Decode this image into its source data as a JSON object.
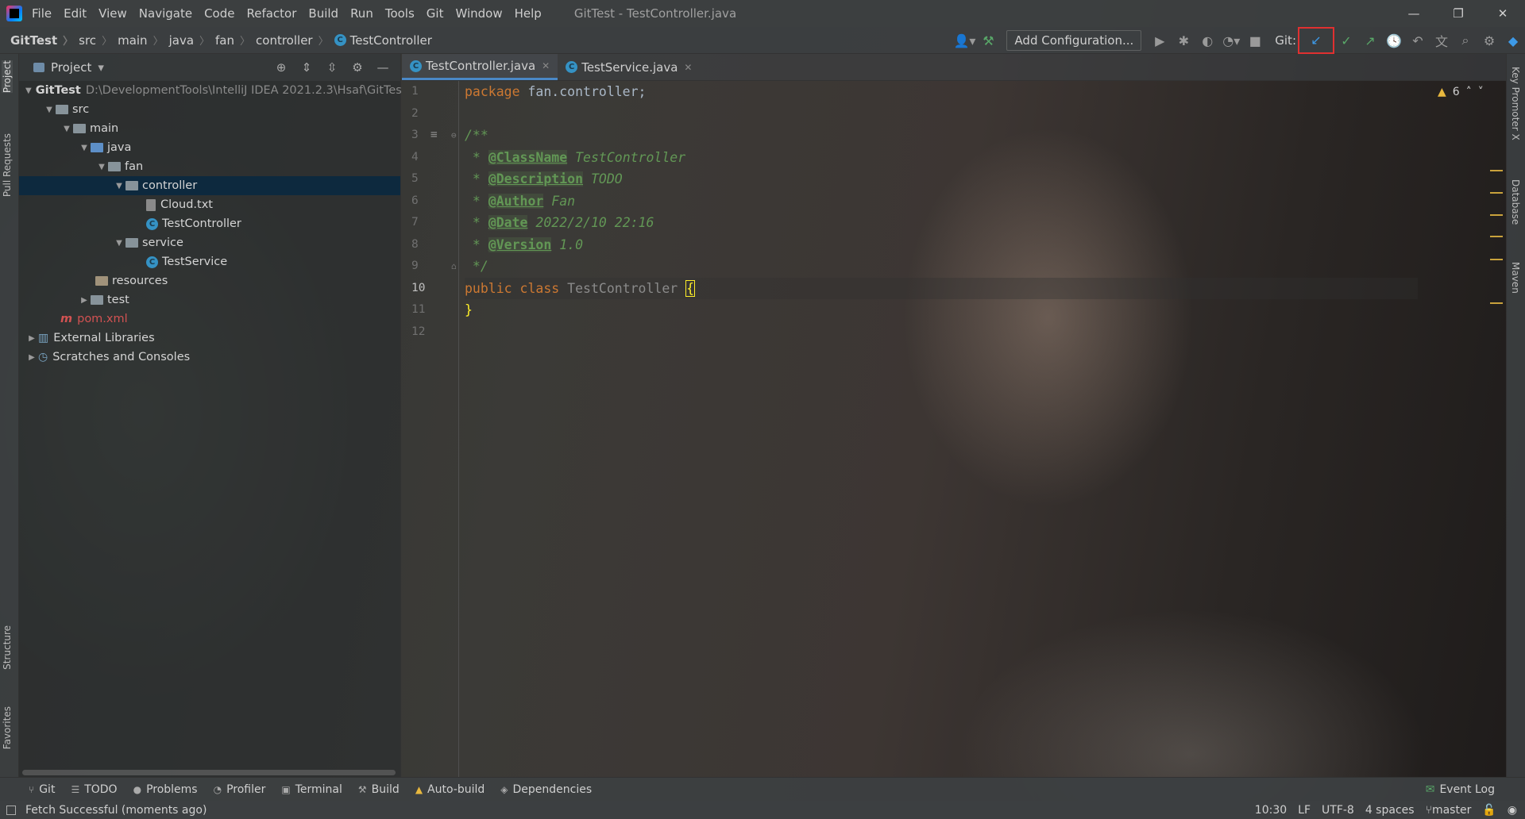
{
  "window": {
    "title": "GitTest - TestController.java",
    "controls": [
      "—",
      "❐",
      "✕"
    ]
  },
  "menu": [
    "File",
    "Edit",
    "View",
    "Navigate",
    "Code",
    "Refactor",
    "Build",
    "Run",
    "Tools",
    "Git",
    "Window",
    "Help"
  ],
  "breadcrumbs": [
    "GitTest",
    "src",
    "main",
    "java",
    "fan",
    "controller",
    "TestController"
  ],
  "toolbar": {
    "add_configuration": "Add Configuration...",
    "git_label": "Git:"
  },
  "left_stripe": {
    "project": "Project",
    "pull_requests": "Pull Requests",
    "structure": "Structure",
    "favorites": "Favorites"
  },
  "project_panel": {
    "title": "Project",
    "tree": [
      {
        "label": "GitTest",
        "path": "D:\\DevelopmentTools\\IntelliJ IDEA 2021.2.3\\Hsaf\\GitTes"
      },
      {
        "label": "src"
      },
      {
        "label": "main"
      },
      {
        "label": "java"
      },
      {
        "label": "fan"
      },
      {
        "label": "controller"
      },
      {
        "label": "Cloud.txt"
      },
      {
        "label": "TestController"
      },
      {
        "label": "service"
      },
      {
        "label": "TestService"
      },
      {
        "label": "resources"
      },
      {
        "label": "test"
      },
      {
        "label": "pom.xml"
      },
      {
        "label": "External Libraries"
      },
      {
        "label": "Scratches and Consoles"
      }
    ]
  },
  "editor": {
    "tabs": [
      "TestController.java",
      "TestService.java"
    ],
    "line_numbers": [
      "1",
      "2",
      "3",
      "4",
      "5",
      "6",
      "7",
      "8",
      "9",
      "10",
      "11",
      "12"
    ],
    "code": {
      "l1_kw": "package",
      "l1_rest": " fan.controller;",
      "l3": "/**",
      "l4_tag": "@ClassName",
      "l4_val": " TestController",
      "l5_tag": "@Description",
      "l5_val": " TODO",
      "l6_tag": "@Author",
      "l6_val": " Fan",
      "l7_tag": "@Date",
      "l7_val": " 2022/2/10 22:16",
      "l8_tag": "@Version",
      "l8_val": " 1.0",
      "l9": " */",
      "l10_kw": "public class",
      "l10_name": " TestController ",
      "l10_brace": "{",
      "l11": "}"
    },
    "inspection_count": "6"
  },
  "right_stripe": {
    "key_promoter": "Key Promoter X",
    "database": "Database",
    "maven": "Maven"
  },
  "bottom_tools": [
    "Git",
    "TODO",
    "Problems",
    "Profiler",
    "Terminal",
    "Build",
    "Auto-build",
    "Dependencies"
  ],
  "event_log": "Event Log",
  "status": {
    "message": "Fetch Successful (moments ago)",
    "position": "10:30",
    "line_sep": "LF",
    "encoding": "UTF-8",
    "indent": "4 spaces",
    "branch": "master"
  },
  "colors": {
    "keyword": "#cc7832",
    "comment": "#629755",
    "selection": "#0d293e",
    "highlight_box": "#e03030"
  }
}
